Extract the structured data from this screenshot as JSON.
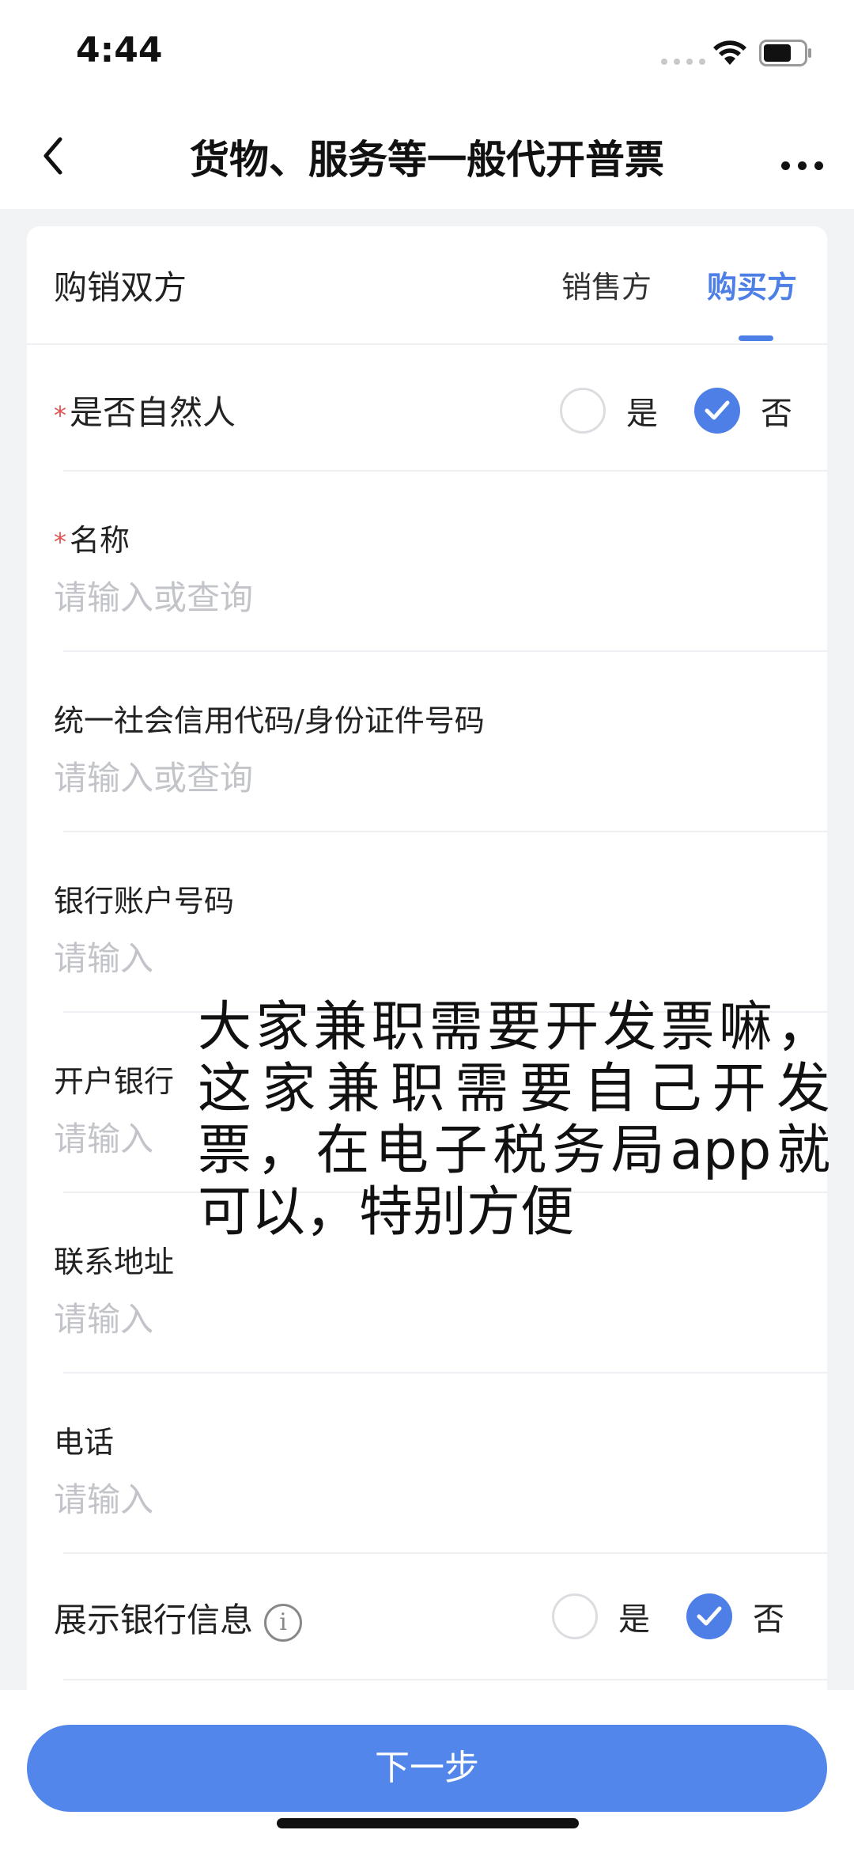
{
  "status_bar": {
    "time": "4:44"
  },
  "nav": {
    "title": "货物、服务等一般代开普票"
  },
  "card": {
    "section_title": "购销双方",
    "tabs": [
      {
        "label": "销售方",
        "active": false
      },
      {
        "label": "购买方",
        "active": true
      }
    ]
  },
  "form": {
    "natural_person": {
      "label": "是否自然人",
      "required_mark": "*",
      "yes": "是",
      "no": "否",
      "selected": "否"
    },
    "name": {
      "label": "名称",
      "required_mark": "*",
      "placeholder": "请输入或查询"
    },
    "credit_code": {
      "label": "统一社会信用代码/身份证件号码",
      "placeholder": "请输入或查询"
    },
    "bank_account": {
      "label": "银行账户号码",
      "placeholder": "请输入"
    },
    "bank": {
      "label": "开户银行",
      "placeholder": "请输入"
    },
    "address": {
      "label": "联系地址",
      "placeholder": "请输入"
    },
    "phone": {
      "label": "电话",
      "placeholder": "请输入"
    },
    "show_bank": {
      "label": "展示银行信息",
      "info_glyph": "i",
      "yes": "是",
      "no": "否",
      "selected": "否"
    }
  },
  "overlay": {
    "text": "大家兼职需要开发票嘛，这家兼职需要自己开发票，在电子税务局app就可以，特别方便"
  },
  "actions": {
    "next_label": "下一步"
  },
  "colors": {
    "accent": "#4d7fe6",
    "button": "#5286ea",
    "placeholder": "#c2c4c9",
    "required": "#e25252"
  }
}
